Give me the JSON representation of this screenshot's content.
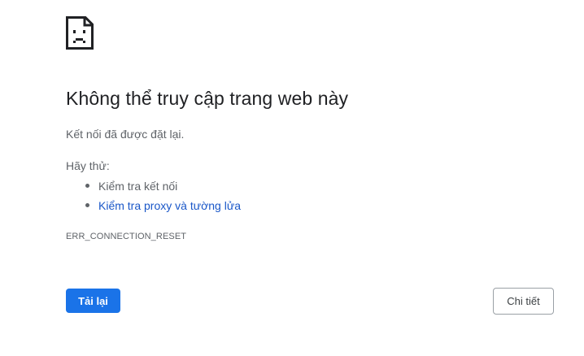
{
  "error_icon": "sad-page-icon",
  "heading": "Không thể truy cập trang web này",
  "message": "Kết nối đã được đặt lại.",
  "try_label": "Hãy thử:",
  "suggestions": [
    {
      "label": "Kiểm tra kết nối",
      "link": false
    },
    {
      "label": "Kiểm tra proxy và tường lửa",
      "link": true
    }
  ],
  "error_code": "ERR_CONNECTION_RESET",
  "buttons": {
    "reload_label": "Tải lại",
    "details_label": "Chi tiết"
  },
  "colors": {
    "accent": "#1a73e8",
    "link": "#1a57c8",
    "text_secondary": "#5f6368",
    "text_primary": "#202124"
  }
}
